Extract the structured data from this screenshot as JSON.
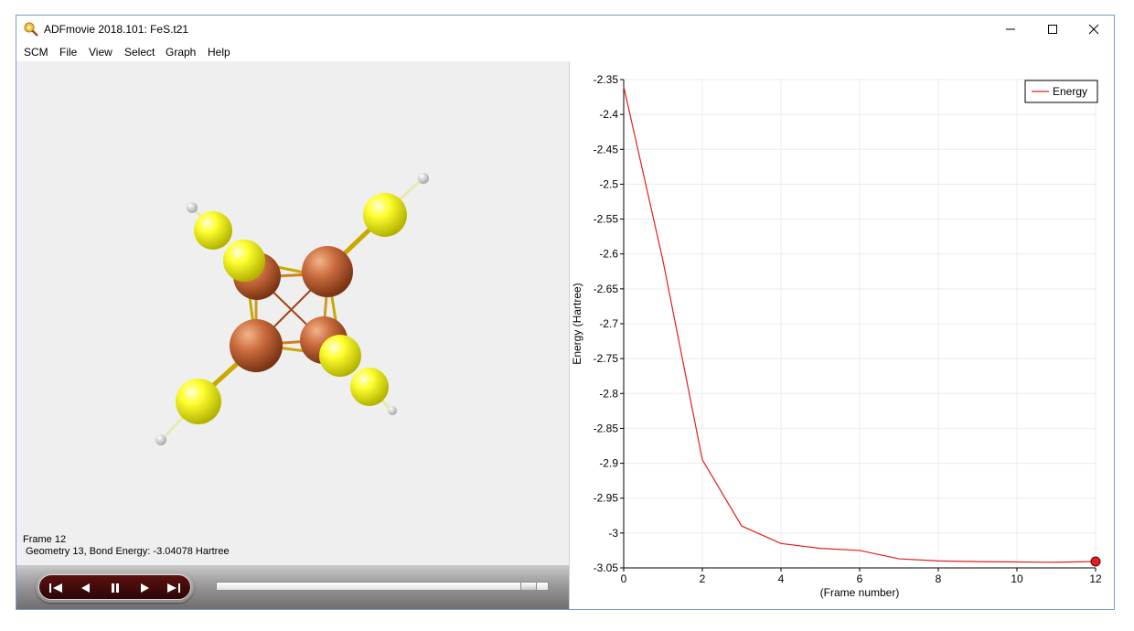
{
  "window": {
    "title": "ADFmovie 2018.101: FeS.t21",
    "accent": "#7a9cc6"
  },
  "menu": [
    "SCM",
    "File",
    "View",
    "Select",
    "Graph",
    "Help"
  ],
  "viewer": {
    "frame_label": "Frame 12",
    "geometry_label": "Geometry 13, Bond Energy: -3.04078 Hartree",
    "slider_value": 12,
    "slider_max": 12
  },
  "controls": [
    "skip-to-start-icon",
    "step-back-icon",
    "pause-icon",
    "play-icon",
    "skip-to-end-icon"
  ],
  "chart_data": {
    "type": "line",
    "xlabel": "(Frame number)",
    "ylabel": "Energy (Hartree)",
    "xlim": [
      0,
      12
    ],
    "ylim": [
      -3.05,
      -2.35
    ],
    "xticks": [
      0,
      2,
      4,
      6,
      8,
      10,
      12
    ],
    "yticks": [
      -2.35,
      -2.4,
      -2.45,
      -2.5,
      -2.55,
      -2.6,
      -2.65,
      -2.7,
      -2.75,
      -2.8,
      -2.85,
      -2.9,
      -2.95,
      -3,
      -3.05
    ],
    "grid": true,
    "legend": "top-right",
    "series": [
      {
        "name": "Energy",
        "color": "#e02020",
        "x": [
          0,
          1,
          2,
          3,
          4,
          5,
          6,
          7,
          8,
          9,
          10,
          11,
          12
        ],
        "y": [
          -2.36,
          -2.61,
          -2.895,
          -2.99,
          -3.015,
          -3.022,
          -3.025,
          -3.037,
          -3.04,
          -3.041,
          -3.0415,
          -3.042,
          -3.04078
        ]
      }
    ],
    "current_frame": 12
  }
}
